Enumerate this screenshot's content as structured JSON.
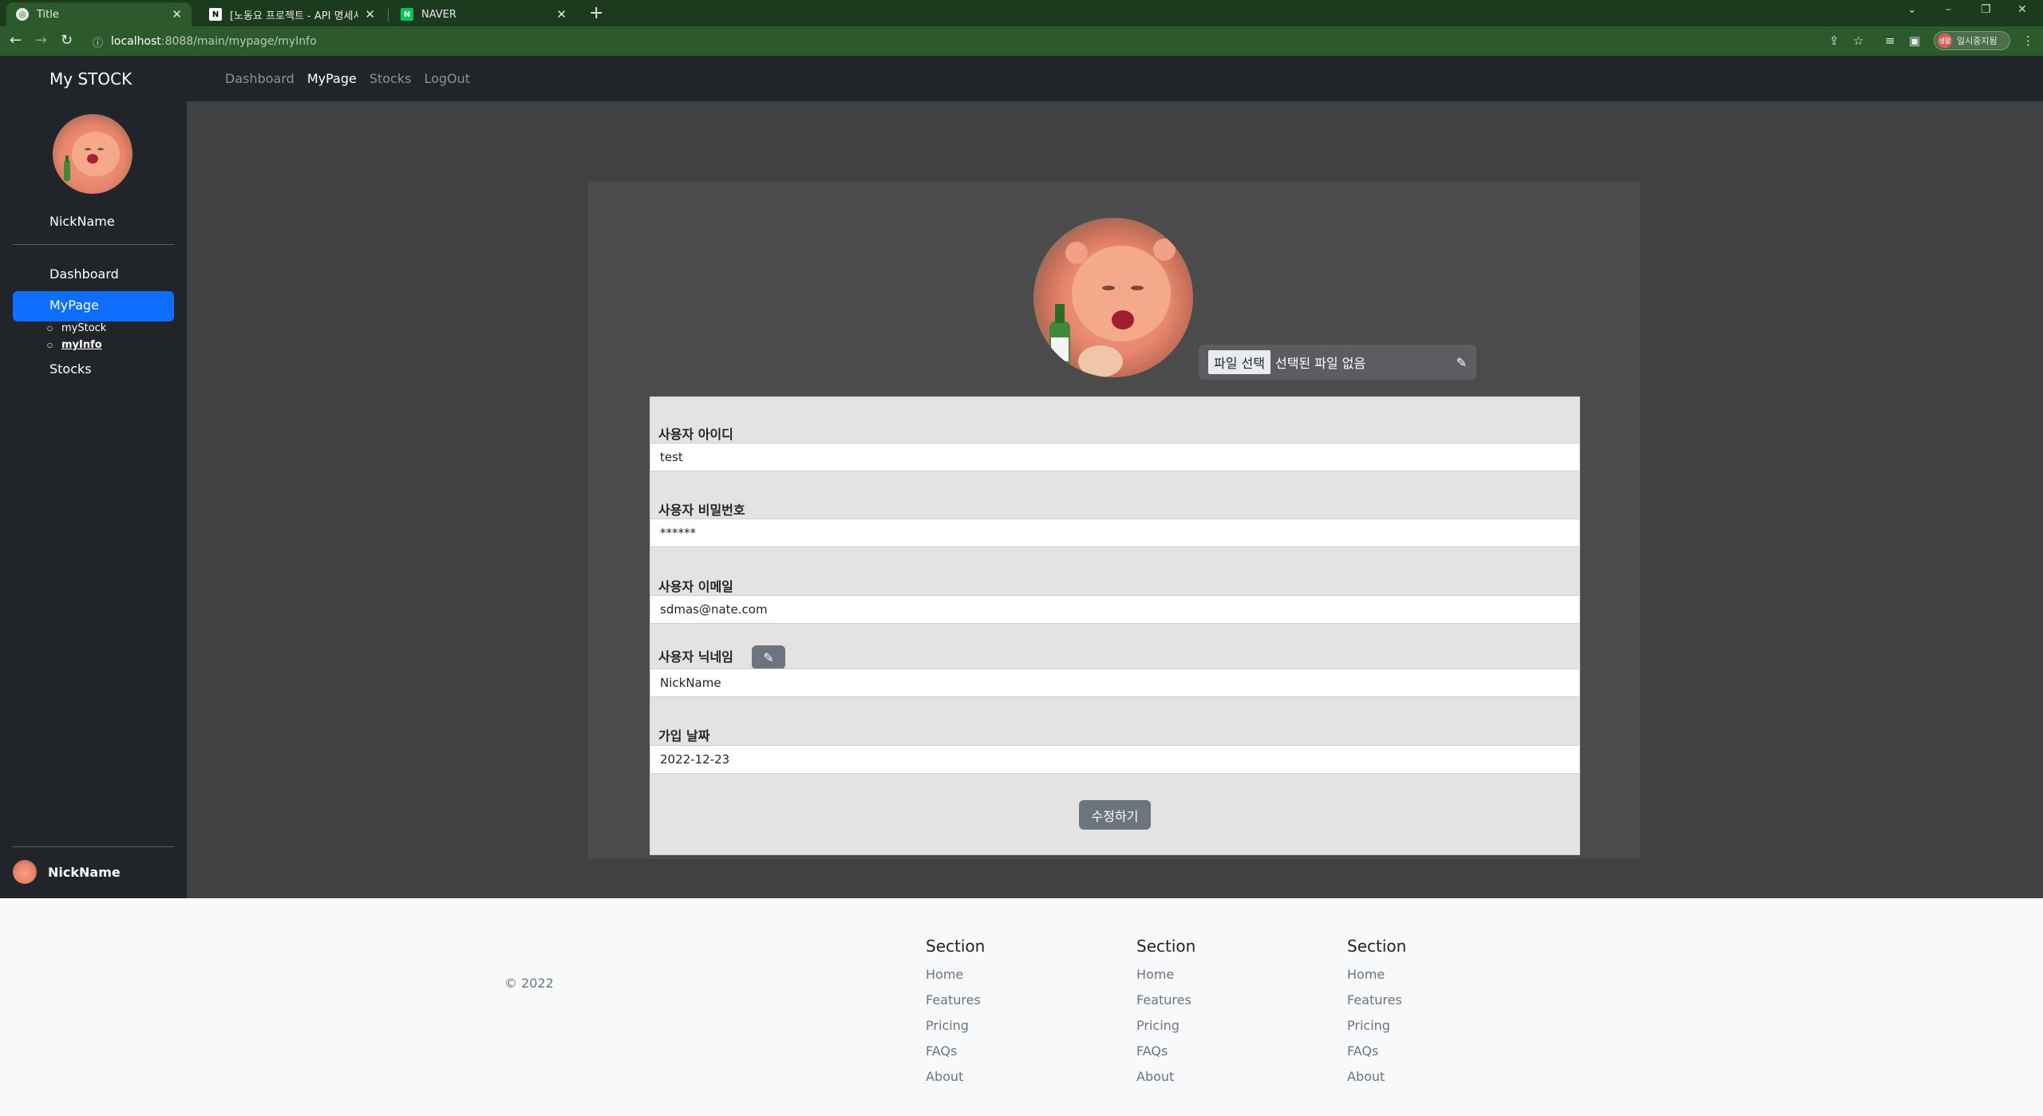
{
  "browser": {
    "tabs": [
      {
        "title": "Title",
        "active": true
      },
      {
        "title": "[노동요 프로젝트 - API 명세서] · ",
        "active": false
      },
      {
        "title": "NAVER",
        "active": false
      }
    ],
    "url_host": "localhost",
    "url_path": ":8088/main/mypage/myInfo",
    "profile_label": "일시중지됨",
    "profile_badge": "생활"
  },
  "navbar": {
    "brand": "My STOCK",
    "links": [
      "Dashboard",
      "MyPage",
      "Stocks",
      "LogOut"
    ],
    "active_link": "MyPage"
  },
  "sidebar": {
    "nickname": "NickName",
    "items": [
      {
        "label": "Dashboard"
      },
      {
        "label": "MyPage",
        "active": true
      },
      {
        "label": "Stocks"
      }
    ],
    "subitems": [
      {
        "label": "myStock"
      },
      {
        "label": "myInfo",
        "current": true
      }
    ],
    "footer_name": "NickName"
  },
  "profile": {
    "file_button": "파일 선택",
    "file_status": "선택된 파일 없음"
  },
  "form": {
    "id_label": "사용자 아이디",
    "id_value": "test",
    "pw_label": "사용자 비밀번호",
    "pw_value": "******",
    "email_label": "사용자 이메일",
    "email_value": "sdmas@nate.com",
    "nick_label": "사용자 닉네임",
    "nick_value": "NickName",
    "date_label": "가입 날짜",
    "date_value": "2022-12-23",
    "submit": "수정하기"
  },
  "footer": {
    "copyright": "© 2022",
    "columns": [
      {
        "heading": "Section",
        "links": [
          "Home",
          "Features",
          "Pricing",
          "FAQs",
          "About"
        ]
      },
      {
        "heading": "Section",
        "links": [
          "Home",
          "Features",
          "Pricing",
          "FAQs",
          "About"
        ]
      },
      {
        "heading": "Section",
        "links": [
          "Home",
          "Features",
          "Pricing",
          "FAQs",
          "About"
        ]
      }
    ]
  },
  "colors": {
    "accent": "#0d6efd",
    "dark": "#212529",
    "main_bg": "#404142",
    "secondary_button": "#6c757d"
  }
}
